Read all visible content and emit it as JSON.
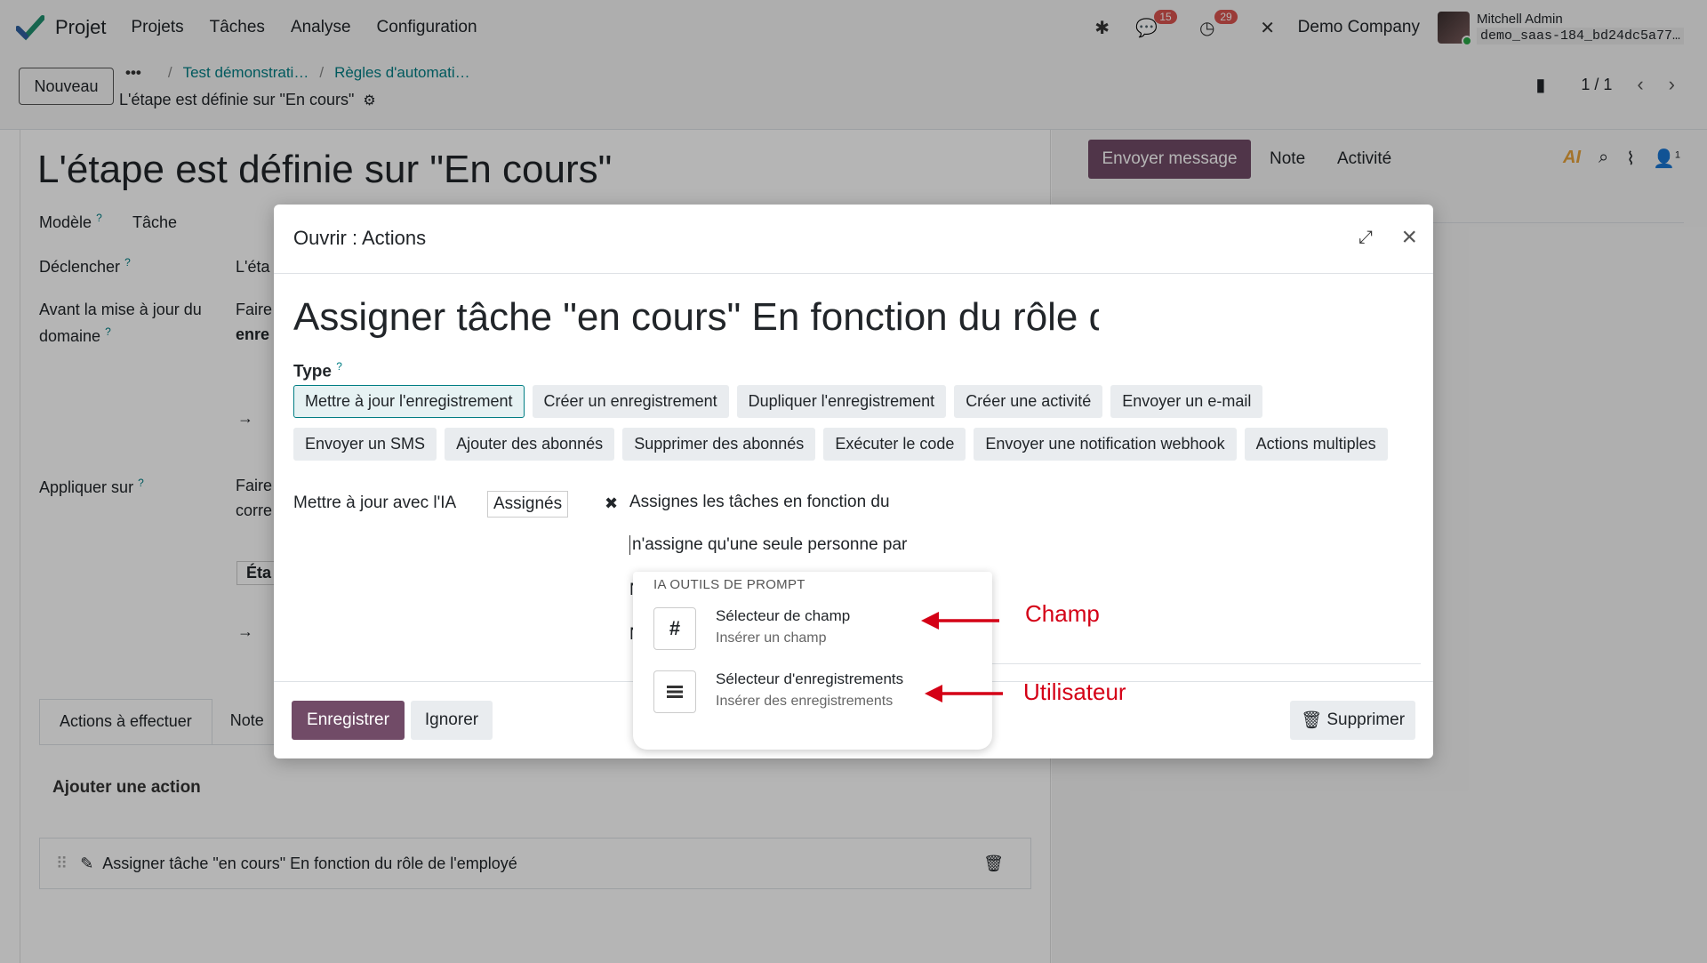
{
  "navbar": {
    "app_name": "Projet",
    "menu": [
      "Projets",
      "Tâches",
      "Analyse",
      "Configuration"
    ],
    "chat_badge": "15",
    "activity_badge": "29",
    "company": "Demo Company",
    "user_name": "Mitchell Admin",
    "db_name": "demo_saas-184_bd24dc5a77…"
  },
  "control": {
    "new_button": "Nouveau",
    "breadcrumb_dots": "•••",
    "breadcrumb": [
      "Test démonstrati…",
      "Règles d'automati…"
    ],
    "record_title": "L'étape est définie sur \"En cours\"",
    "pager": "1 / 1"
  },
  "form": {
    "title": "L'étape est définie sur \"En cours\"",
    "model_label": "Modèle",
    "model_value": "Tâche",
    "trigger_label": "Déclencher",
    "trigger_value": "L'éta",
    "before_label_1": "Avant la mise à jour du",
    "before_label_2": "domaine",
    "before_value_1": "Faire",
    "before_value_2": "enre",
    "apply_label": "Appliquer sur",
    "apply_value_1": "Faire",
    "apply_value_2": "corre",
    "apply_value_3": "Éta",
    "help": "?",
    "tab_actions": "Actions à effectuer",
    "tab_notes": "Note",
    "add_action": "Ajouter une action",
    "action_row": "Assigner tâche \"en cours\" En fonction du rôle de l'employé"
  },
  "chatter": {
    "send_message": "Envoyer message",
    "note": "Note",
    "activity": "Activité",
    "ai_logo": "AI",
    "followers_count": "1"
  },
  "modal": {
    "title": "Ouvrir : Actions",
    "name": "Assigner tâche \"en cours\" En fonction du rôle de l'employé",
    "type_label": "Type",
    "type_help": "?",
    "type_options": [
      "Mettre à jour l'enregistrement",
      "Créer un enregistrement",
      "Dupliquer l'enregistrement",
      "Créer une activité",
      "Envoyer un e-mail",
      "Envoyer un SMS",
      "Ajouter des abonnés",
      "Supprimer des abonnés",
      "Exécuter le code",
      "Envoyer une notification webhook",
      "Actions multiples"
    ],
    "update_ai_label": "Mettre à jour avec l'IA",
    "field_tag": "Assignés",
    "prompt_line1": "Assignes les tâches en fonction du",
    "prompt_line2": "n'assigne qu'une  seule personne par",
    "prompt_hidden1": "N",
    "prompt_hidden2": "N",
    "save": "Enregistrer",
    "ignore": "Ignorer",
    "delete": "Supprimer"
  },
  "popover": {
    "title": "IA OUTILS DE PROMPT",
    "items": [
      {
        "icon": "hash-icon",
        "label": "Sélecteur de champ",
        "sub": "Insérer un champ"
      },
      {
        "icon": "list-icon",
        "label": "Sélecteur d'enregistrements",
        "sub": "Insérer des enregistrements"
      }
    ]
  },
  "annotations": {
    "champ": "Champ",
    "utilisateur": "Utilisateur",
    "color": "#d40016"
  }
}
